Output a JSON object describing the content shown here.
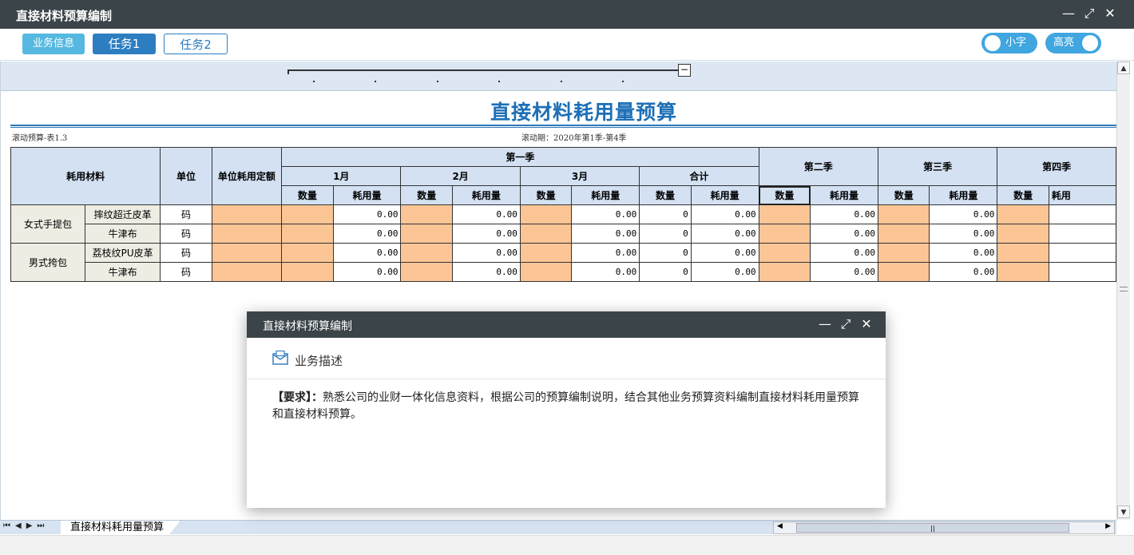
{
  "window": {
    "title": "直接材料预算编制"
  },
  "toolbar": {
    "info_label": "业务信息",
    "task1_label": "任务1",
    "task2_label": "任务2",
    "small_font_label": "小字",
    "highlight_label": "高亮"
  },
  "report": {
    "title": "直接材料耗用量预算",
    "table_no": "滚动预算-表1.3",
    "period": "滚动期：2020年第1季-第4季"
  },
  "table": {
    "h_material": "耗用材料",
    "h_unit": "单位",
    "h_quota": "单位耗用定额",
    "h_q1": "第一季",
    "h_q2": "第二季",
    "h_q3": "第三季",
    "h_q4": "第四季",
    "h_m1": "1月",
    "h_m2": "2月",
    "h_m3": "3月",
    "h_total": "合计",
    "h_qty": "数量",
    "h_use": "耗用量",
    "h_use_cut": "耗用",
    "groups": [
      "女式手提包",
      "男式挎包"
    ],
    "rows": [
      {
        "material": "摔纹超迁皮革",
        "unit": "码",
        "m1": "0.00",
        "m2": "0.00",
        "m3": "0.00",
        "tq": "0",
        "tu": "0.00",
        "q2": "0.00",
        "q3": "0.00"
      },
      {
        "material": "牛津布",
        "unit": "码",
        "m1": "0.00",
        "m2": "0.00",
        "m3": "0.00",
        "tq": "0",
        "tu": "0.00",
        "q2": "0.00",
        "q3": "0.00"
      },
      {
        "material": "荔枝纹PU皮革",
        "unit": "码",
        "m1": "0.00",
        "m2": "0.00",
        "m3": "0.00",
        "tq": "0",
        "tu": "0.00",
        "q2": "0.00",
        "q3": "0.00"
      },
      {
        "material": "牛津布",
        "unit": "码",
        "m1": "0.00",
        "m2": "0.00",
        "m3": "0.00",
        "tq": "0",
        "tu": "0.00",
        "q2": "0.00",
        "q3": "0.00"
      }
    ]
  },
  "sheet_tab": {
    "label": "直接材料耗用量预算"
  },
  "modal": {
    "title": "直接材料预算编制",
    "section": "业务描述",
    "req_label": "【要求】：",
    "req_text": "熟悉公司的业财一体化信息资料，根据公司的预算编制说明，结合其他业务预算资料编制直接材料耗用量预算和直接材料预算。"
  },
  "colors": {
    "titlebar": "#3b4448",
    "accent": "#2d7ec1",
    "input_cell": "#fcc596",
    "header_cell": "#d3e1f2"
  }
}
